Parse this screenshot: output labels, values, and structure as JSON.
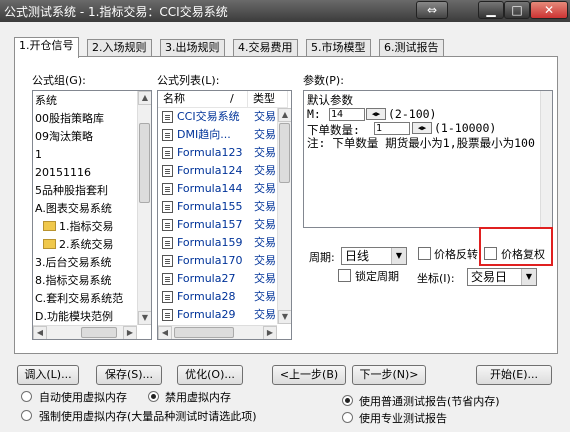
{
  "window": {
    "title": "公式测试系统 - 1.指标交易：CCI交易系统",
    "switch_glyph": "⇔",
    "min_glyph": "▁",
    "max_glyph": "□",
    "close_glyph": "✕"
  },
  "tabs": [
    "1.开仓信号",
    "2.入场规则",
    "3.出场规则",
    "4.交易费用",
    "5.市场模型",
    "6.测试报告"
  ],
  "groups": {
    "label": "公式组(G):",
    "items": [
      "系统",
      "00股指策略库",
      "09淘汰策略",
      "1",
      "20151116",
      "5品种股指套利",
      "A.图表交易系统",
      "1.指标交易",
      "2.系统交易",
      "3.后台交易系统",
      "8.指标交易系统",
      "C.套利交易系统范",
      "D.功能模块范例"
    ]
  },
  "formulas": {
    "label": "公式列表(L):",
    "header_name": "名称",
    "header_sep": "/",
    "header_type": "类型",
    "rows": [
      {
        "name": "CCI交易系统",
        "type": "交易"
      },
      {
        "name": "DMI趋向...",
        "type": "交易"
      },
      {
        "name": "Formula123",
        "type": "交易"
      },
      {
        "name": "Formula124",
        "type": "交易"
      },
      {
        "name": "Formula144",
        "type": "交易"
      },
      {
        "name": "Formula155",
        "type": "交易"
      },
      {
        "name": "Formula157",
        "type": "交易"
      },
      {
        "name": "Formula159",
        "type": "交易"
      },
      {
        "name": "Formula170",
        "type": "交易"
      },
      {
        "name": "Formula27",
        "type": "交易"
      },
      {
        "name": "Formula28",
        "type": "交易"
      },
      {
        "name": "Formula29",
        "type": "交易"
      }
    ]
  },
  "params": {
    "label": "参数(P):",
    "default_label": "默认参数",
    "m_label": "M:",
    "m_value": "14",
    "m_range": "(2-100)",
    "qty_label": "下单数量:",
    "qty_value": "1",
    "qty_range": "(1-10000)",
    "note": "注: 下单数量 期货最小为1,股票最小为100"
  },
  "period": {
    "label": "周期:",
    "value": "日线",
    "lock_label": "锁定周期"
  },
  "options": {
    "reverse_label": "价格反转",
    "restore_label": "价格复权"
  },
  "coord": {
    "label": "坐标(I):",
    "value": "交易日"
  },
  "buttons": {
    "import": "调入(L)...",
    "save": "保存(S)...",
    "optimize": "优化(O)...",
    "prev": "<上一步(B)",
    "next": "下一步(N)>",
    "start": "开始(E)..."
  },
  "memory": {
    "auto": "自动使用虚拟内存",
    "disable": "禁用虚拟内存",
    "force": "强制使用虚拟内存(大量品种测试时请选此项)",
    "selected": "disable"
  },
  "report": {
    "normal": "使用普通测试报告(节省内存)",
    "pro": "使用专业测试报告",
    "selected": "normal"
  }
}
